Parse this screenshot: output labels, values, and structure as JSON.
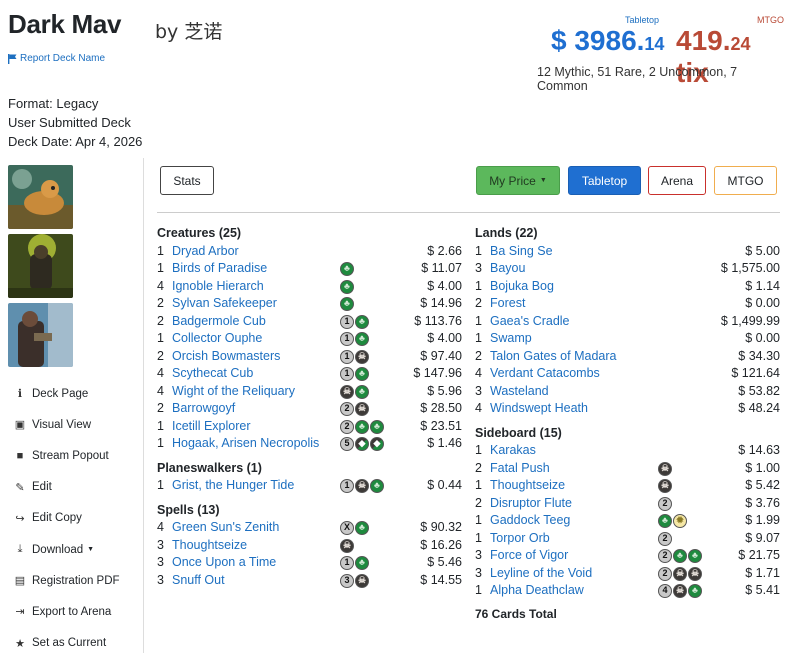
{
  "header": {
    "title": "Dark Mav",
    "by": "by 芝诺",
    "report_link": "Report Deck Name",
    "tabletop_label": "Tabletop",
    "tabletop_price_main": "$ 3986.",
    "tabletop_price_cents": "14",
    "mtgo_label": "MTGO",
    "mtgo_price_main": "419.",
    "mtgo_price_cents": "24",
    "mtgo_unit": " tix",
    "rarity": "12 Mythic, 51 Rare, 2 Uncommon, 7 Common"
  },
  "meta": {
    "format": "Format: Legacy",
    "submitted": "User Submitted Deck",
    "date": "Deck Date: Apr 4, 2026"
  },
  "sidebar": {
    "items": [
      {
        "label": "Deck Page",
        "icon": "info-icon"
      },
      {
        "label": "Visual View",
        "icon": "image-icon"
      },
      {
        "label": "Stream Popout",
        "icon": "video-icon"
      },
      {
        "label": "Edit",
        "icon": "edit-icon"
      },
      {
        "label": "Edit Copy",
        "icon": "share-icon"
      },
      {
        "label": "Download",
        "icon": "download-icon"
      },
      {
        "label": "Registration PDF",
        "icon": "file-icon"
      },
      {
        "label": "Export to Arena",
        "icon": "export-icon"
      },
      {
        "label": "Set as Current",
        "icon": "star-icon"
      }
    ]
  },
  "buttons": {
    "stats": "Stats",
    "my_price": "My Price",
    "tabletop": "Tabletop",
    "arena": "Arena",
    "mtgo": "MTGO"
  },
  "colors": {
    "link": "#1d6fc0",
    "tabletop": "#1f6fd1",
    "mtgo": "#b94a36",
    "green_btn": "#5cb85c"
  },
  "sections": {
    "creatures": {
      "title": "Creatures (25)",
      "rows": [
        {
          "qty": "1",
          "name": "Dryad Arbor",
          "cost": [],
          "price": "$ 2.66"
        },
        {
          "qty": "1",
          "name": "Birds of Paradise",
          "cost": [
            "G"
          ],
          "price": "$ 11.07"
        },
        {
          "qty": "4",
          "name": "Ignoble Hierarch",
          "cost": [
            "G"
          ],
          "price": "$ 4.00"
        },
        {
          "qty": "2",
          "name": "Sylvan Safekeeper",
          "cost": [
            "G"
          ],
          "price": "$ 14.96"
        },
        {
          "qty": "2",
          "name": "Badgermole Cub",
          "cost": [
            "1",
            "G"
          ],
          "price": "$ 113.76"
        },
        {
          "qty": "1",
          "name": "Collector Ouphe",
          "cost": [
            "1",
            "G"
          ],
          "price": "$ 4.00"
        },
        {
          "qty": "2",
          "name": "Orcish Bowmasters",
          "cost": [
            "1",
            "B"
          ],
          "price": "$ 97.40"
        },
        {
          "qty": "4",
          "name": "Scythecat Cub",
          "cost": [
            "1",
            "G"
          ],
          "price": "$ 147.96"
        },
        {
          "qty": "4",
          "name": "Wight of the Reliquary",
          "cost": [
            "B",
            "G"
          ],
          "price": "$ 5.96"
        },
        {
          "qty": "2",
          "name": "Barrowgoyf",
          "cost": [
            "2",
            "B"
          ],
          "price": "$ 28.50"
        },
        {
          "qty": "1",
          "name": "Icetill Explorer",
          "cost": [
            "2",
            "G",
            "G"
          ],
          "price": "$ 23.51"
        },
        {
          "qty": "1",
          "name": "Hogaak, Arisen Necropolis",
          "cost": [
            "5",
            "H",
            "H"
          ],
          "price": "$ 1.46"
        }
      ]
    },
    "planeswalkers": {
      "title": "Planeswalkers (1)",
      "rows": [
        {
          "qty": "1",
          "name": "Grist, the Hunger Tide",
          "cost": [
            "1",
            "B",
            "G"
          ],
          "price": "$ 0.44"
        }
      ]
    },
    "spells": {
      "title": "Spells (13)",
      "rows": [
        {
          "qty": "4",
          "name": "Green Sun's Zenith",
          "cost": [
            "X",
            "G"
          ],
          "price": "$ 90.32"
        },
        {
          "qty": "3",
          "name": "Thoughtseize",
          "cost": [
            "B"
          ],
          "price": "$ 16.26"
        },
        {
          "qty": "3",
          "name": "Once Upon a Time",
          "cost": [
            "1",
            "G"
          ],
          "price": "$ 5.46"
        },
        {
          "qty": "3",
          "name": "Snuff Out",
          "cost": [
            "3",
            "B"
          ],
          "price": "$ 14.55"
        }
      ]
    },
    "lands": {
      "title": "Lands (22)",
      "rows": [
        {
          "qty": "1",
          "name": "Ba Sing Se",
          "cost": [],
          "price": "$ 5.00"
        },
        {
          "qty": "3",
          "name": "Bayou",
          "cost": [],
          "price": "$ 1,575.00"
        },
        {
          "qty": "1",
          "name": "Bojuka Bog",
          "cost": [],
          "price": "$ 1.14"
        },
        {
          "qty": "2",
          "name": "Forest",
          "cost": [],
          "price": "$ 0.00"
        },
        {
          "qty": "1",
          "name": "Gaea's Cradle",
          "cost": [],
          "price": "$ 1,499.99"
        },
        {
          "qty": "1",
          "name": "Swamp",
          "cost": [],
          "price": "$ 0.00"
        },
        {
          "qty": "2",
          "name": "Talon Gates of Madara",
          "cost": [],
          "price": "$ 34.30"
        },
        {
          "qty": "4",
          "name": "Verdant Catacombs",
          "cost": [],
          "price": "$ 121.64"
        },
        {
          "qty": "3",
          "name": "Wasteland",
          "cost": [],
          "price": "$ 53.82"
        },
        {
          "qty": "4",
          "name": "Windswept Heath",
          "cost": [],
          "price": "$ 48.24"
        }
      ]
    },
    "sideboard": {
      "title": "Sideboard (15)",
      "rows": [
        {
          "qty": "1",
          "name": "Karakas",
          "cost": [],
          "price": "$ 14.63"
        },
        {
          "qty": "2",
          "name": "Fatal Push",
          "cost": [
            "B"
          ],
          "price": "$ 1.00"
        },
        {
          "qty": "1",
          "name": "Thoughtseize",
          "cost": [
            "B"
          ],
          "price": "$ 5.42"
        },
        {
          "qty": "2",
          "name": "Disruptor Flute",
          "cost": [
            "2"
          ],
          "price": "$ 3.76"
        },
        {
          "qty": "1",
          "name": "Gaddock Teeg",
          "cost": [
            "G",
            "W"
          ],
          "price": "$ 1.99"
        },
        {
          "qty": "1",
          "name": "Torpor Orb",
          "cost": [
            "2"
          ],
          "price": "$ 9.07"
        },
        {
          "qty": "3",
          "name": "Force of Vigor",
          "cost": [
            "2",
            "G",
            "G"
          ],
          "price": "$ 21.75"
        },
        {
          "qty": "3",
          "name": "Leyline of the Void",
          "cost": [
            "2",
            "B",
            "B"
          ],
          "price": "$ 1.71"
        },
        {
          "qty": "1",
          "name": "Alpha Deathclaw",
          "cost": [
            "4",
            "B",
            "G"
          ],
          "price": "$ 5.41"
        }
      ]
    },
    "total": "76 Cards Total"
  }
}
